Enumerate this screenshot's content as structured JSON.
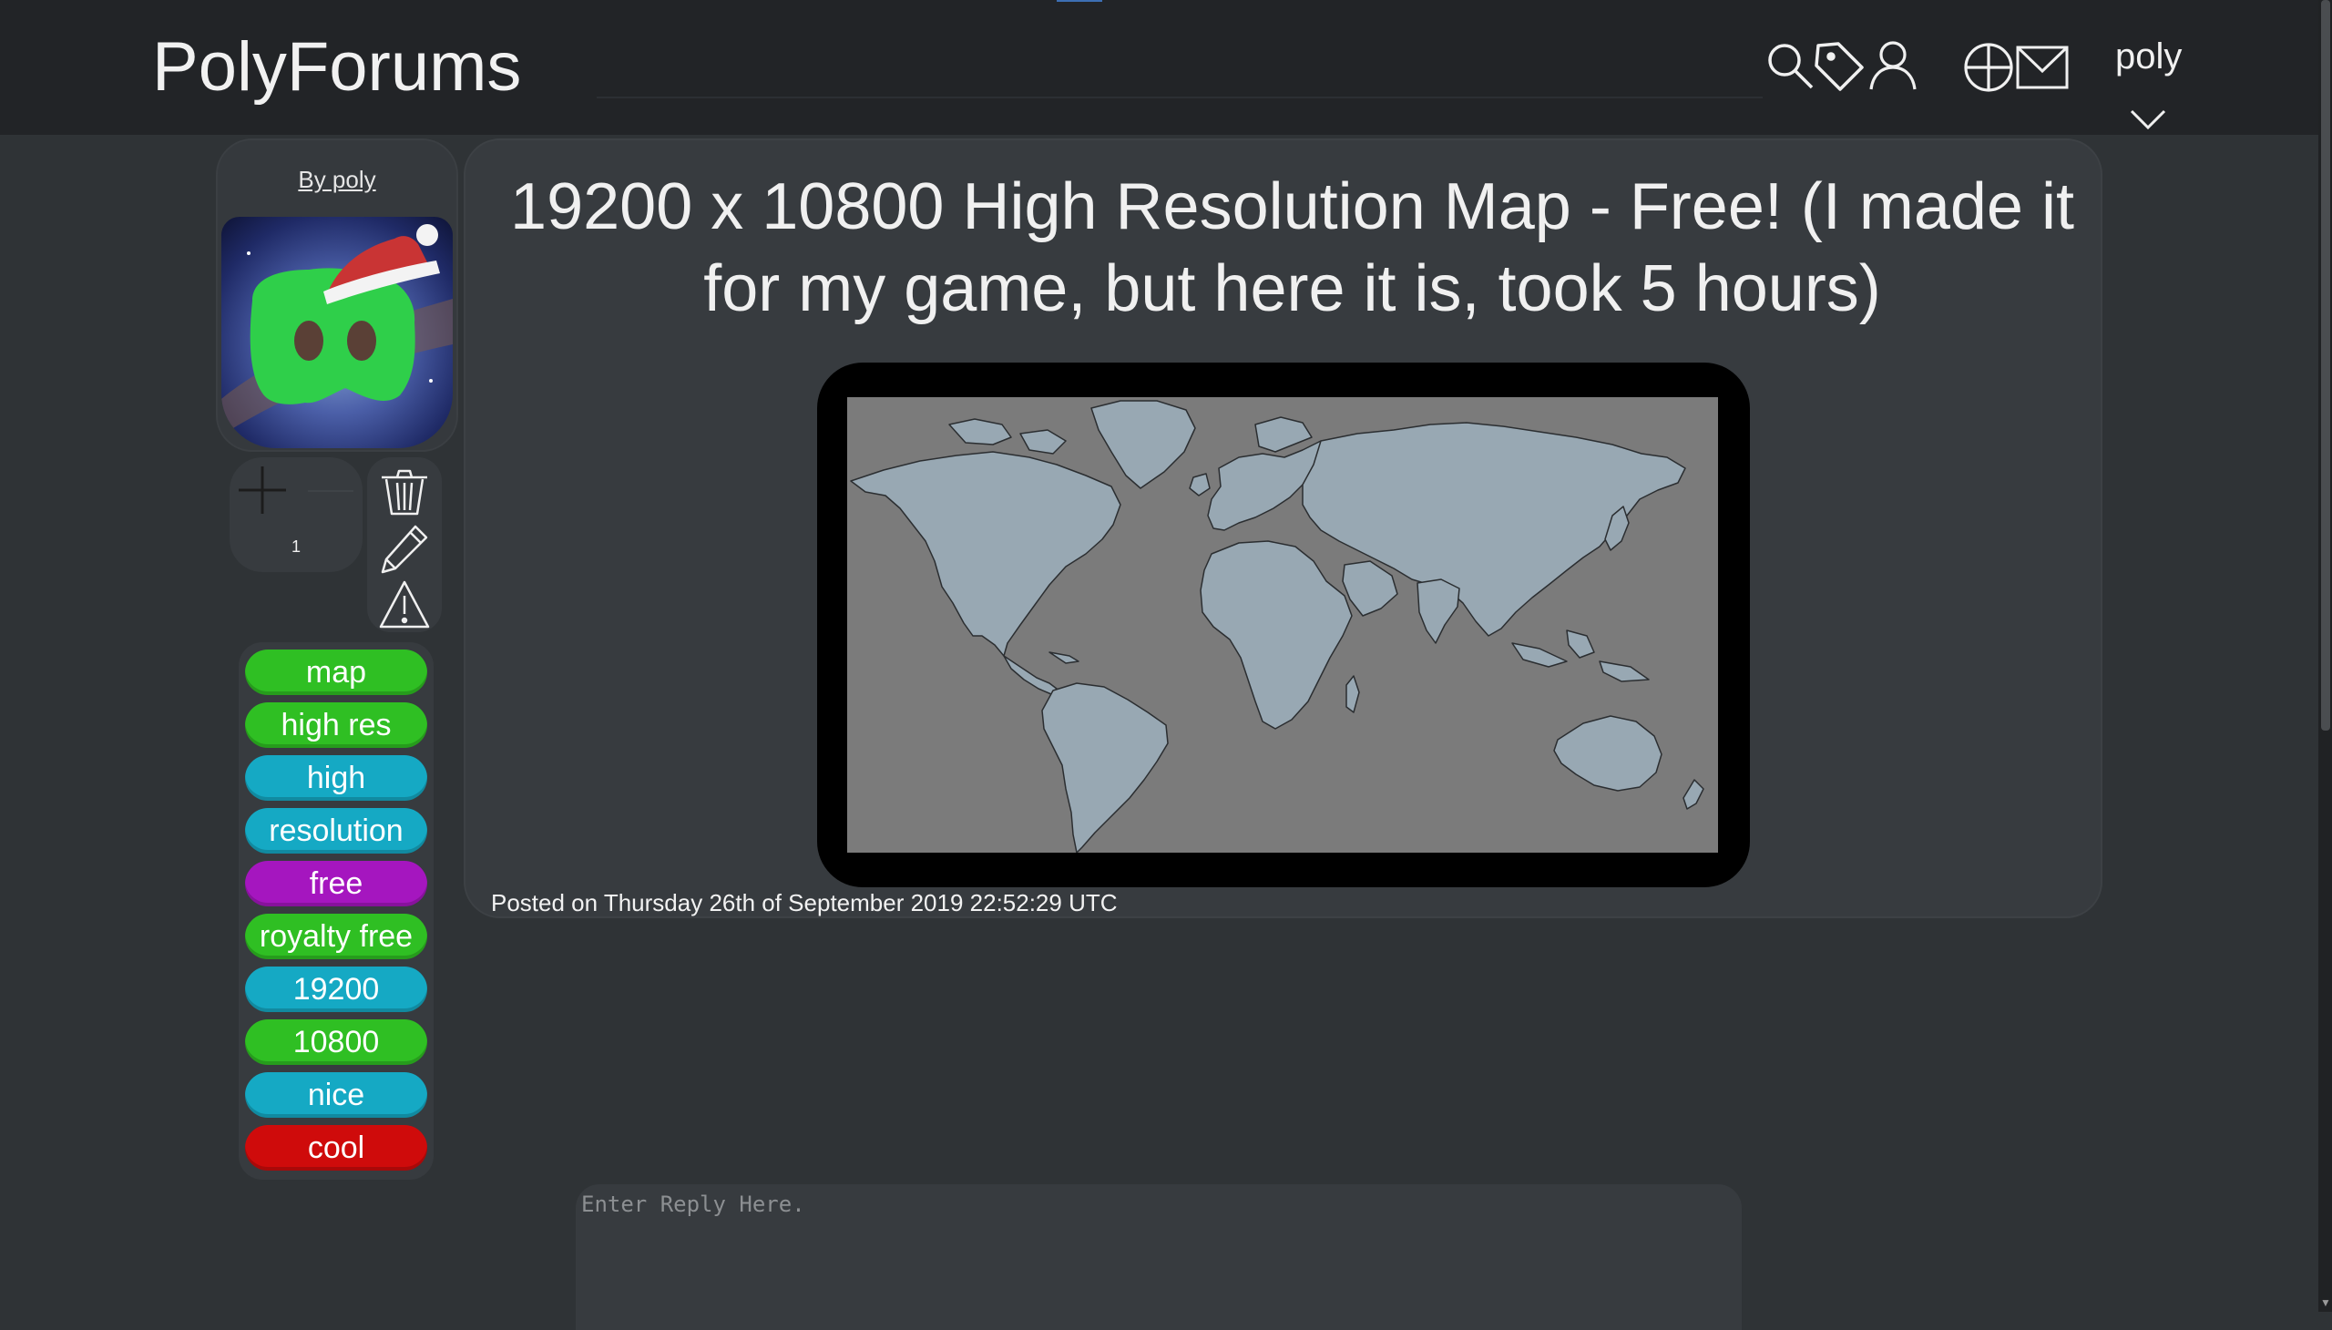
{
  "header": {
    "logo": "PolyForums",
    "username": "poly",
    "icons": [
      "search-icon",
      "tag-icon",
      "user-icon",
      "create-post-icon",
      "mail-icon",
      "chevron-down-icon"
    ]
  },
  "sidebar": {
    "by_label": "By poly"
  },
  "vote": {
    "count": "1"
  },
  "actions": [
    "trash-icon",
    "edit-icon",
    "report-icon"
  ],
  "tags": [
    {
      "label": "map",
      "color": "#2fbf23"
    },
    {
      "label": "high res",
      "color": "#2fbf23"
    },
    {
      "label": "high",
      "color": "#15a9c4"
    },
    {
      "label": "resolution",
      "color": "#15a9c4"
    },
    {
      "label": "free",
      "color": "#a516bf"
    },
    {
      "label": "royalty free",
      "color": "#2fbf23"
    },
    {
      "label": "19200",
      "color": "#15a9c4"
    },
    {
      "label": "10800",
      "color": "#2fbf23"
    },
    {
      "label": "nice",
      "color": "#15a9c4"
    },
    {
      "label": "cool",
      "color": "#cf0b0b"
    }
  ],
  "post": {
    "title": "19200 x 10800 High Resolution Map - Free! (I made it for my game, but here it is, took 5 hours)",
    "posted": "Posted on Thursday 26th of September 2019 22:52:29 UTC"
  },
  "reply": {
    "placeholder": "Enter Reply Here."
  },
  "colors": {
    "background": "#2f3336",
    "header": "#222427",
    "panel": "#373b3f",
    "map_ocean": "#7b7b7b",
    "map_land": "#98a8b3"
  }
}
